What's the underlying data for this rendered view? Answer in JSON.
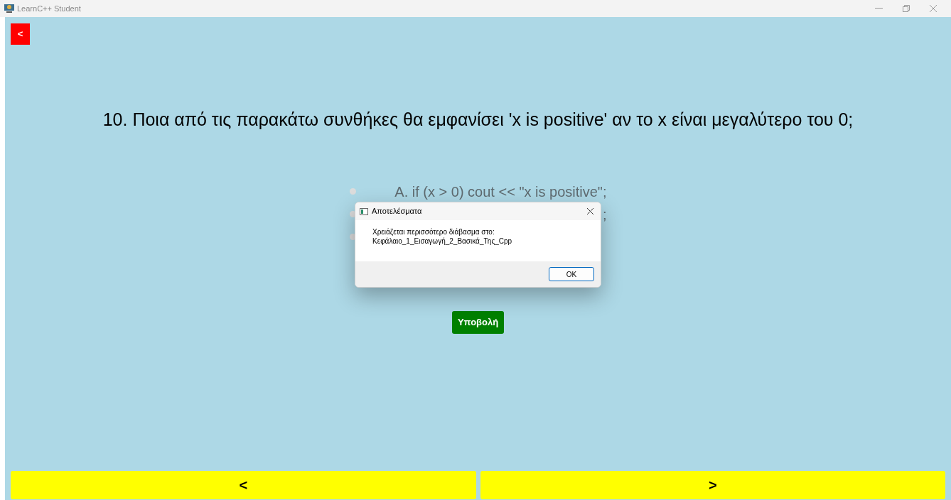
{
  "window": {
    "title": "LearnC++ Student"
  },
  "back_button": "<",
  "question": "10. Ποια από τις παρακάτω συνθήκες θα εμφανίσει 'x is positive' αν το x είναι μεγαλύτερο του 0;",
  "options": [
    {
      "text": "A. if (x > 0) cout << \"x is positive\";",
      "selected": false
    },
    {
      "text": ";",
      "selected": false
    },
    {
      "selected": false
    }
  ],
  "submit_button": "Υποβολή",
  "nav_buttons": [
    "<",
    ">"
  ],
  "dialog": {
    "title": "Αποτελέσματα",
    "lines": [
      "Χρειάζεται περισσότερο διάβασμα στο:",
      "Κεφάλαιο_1_Εισαγωγή_2_Βασικά_Της_Cpp"
    ],
    "button": "OK"
  }
}
